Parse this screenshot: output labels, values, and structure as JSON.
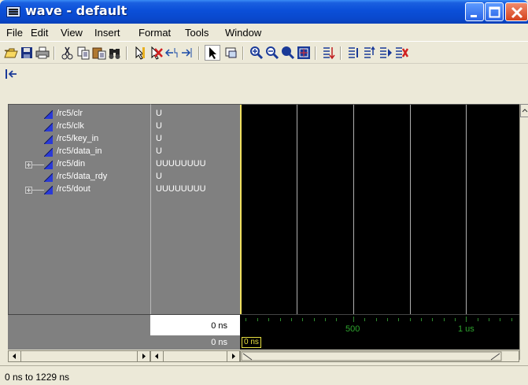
{
  "window": {
    "title": "wave - default"
  },
  "menu": [
    "File",
    "Edit",
    "View",
    "Insert",
    "Format",
    "Tools",
    "Window"
  ],
  "toolbar_icons": [
    "open-icon",
    "save-icon",
    "print-icon",
    "cut-icon",
    "copy-icon",
    "paste-icon",
    "find-icon",
    "insert-cursor-icon",
    "delete-cursor-icon",
    "previous-edge-icon",
    "next-edge-icon",
    "select-mode-icon",
    "zoom-mode-icon",
    "zoom-in-icon",
    "zoom-out-icon",
    "zoom-full-icon",
    "zoom-fit-icon",
    "run-icon",
    "step-icon",
    "step-over-icon",
    "continue-icon",
    "break-icon"
  ],
  "toolbar2_icons": [
    "restart-icon"
  ],
  "signals": [
    {
      "name": "/rc5/clr",
      "value": "U",
      "expandable": false
    },
    {
      "name": "/rc5/clk",
      "value": "U",
      "expandable": false
    },
    {
      "name": "/rc5/key_in",
      "value": "U",
      "expandable": false
    },
    {
      "name": "/rc5/data_in",
      "value": "U",
      "expandable": false
    },
    {
      "name": "/rc5/din",
      "value": "UUUUUUUU",
      "expandable": true
    },
    {
      "name": "/rc5/data_rdy",
      "value": "U",
      "expandable": false
    },
    {
      "name": "/rc5/dout",
      "value": "UUUUUUUU",
      "expandable": true
    }
  ],
  "cursor": {
    "time": "0 ns",
    "delta": "0 ns",
    "tag": "0 ns"
  },
  "ruler": {
    "labels": [
      "500",
      "1 us"
    ]
  },
  "status": {
    "range": "0 ns to 1229 ns"
  },
  "colors": {
    "signal_icon": "#2a3ad8",
    "cursor": "#f0e060",
    "ruler_text": "#2ea52e"
  }
}
